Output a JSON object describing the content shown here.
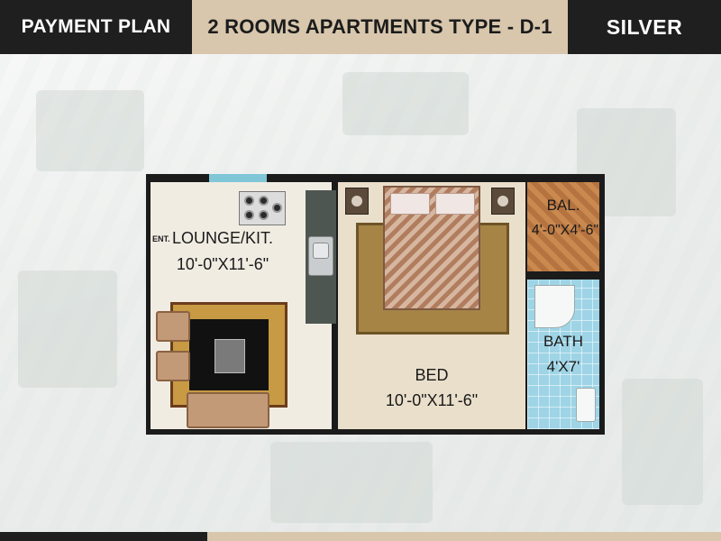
{
  "header": {
    "left_title": "PAYMENT PLAN",
    "center_title": "2 ROOMS APARTMENTS TYPE - D-1",
    "right_title": "SILVER"
  },
  "floor_plan": {
    "entrance_label": "ENT.",
    "lounge": {
      "name": "LOUNGE/KIT.",
      "size": "10'-0\"X11'-6\""
    },
    "bed": {
      "name": "BED",
      "size": "10'-0\"X11'-6\""
    },
    "balcony": {
      "name": "BAL.",
      "size": "4'-0\"X4'-6\""
    },
    "bath": {
      "name": "BATH",
      "size": "4'X7'"
    }
  },
  "colors": {
    "header_dark": "#1f1f1f",
    "header_beige": "#d8c7ad",
    "wall": "#1b1b1b",
    "bath_tile": "#9ed4e6",
    "balcony_floor": "#bd7c45"
  }
}
